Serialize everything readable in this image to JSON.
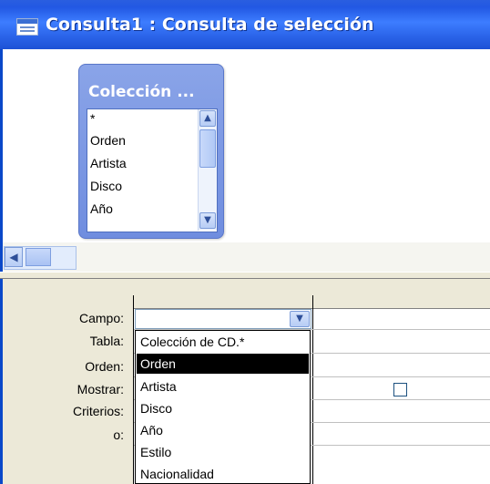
{
  "window": {
    "title": "Consulta1 : Consulta de selección"
  },
  "table_box": {
    "title": "Colección ...",
    "fields": [
      "*",
      "Orden",
      "Artista",
      "Disco",
      "Año"
    ]
  },
  "grid": {
    "row_labels": [
      "Campo:",
      "Tabla:",
      "Orden:",
      "Mostrar:",
      "Criterios:",
      "o:"
    ]
  },
  "dropdown": {
    "options": [
      "Colección de CD.*",
      "Orden",
      "Artista",
      "Disco",
      "Año",
      "Estilo",
      "Nacionalidad"
    ],
    "selected": "Orden"
  },
  "icons": {
    "title_icon": "query-window-icon",
    "scroll_left": "arrow-left-icon",
    "scroll_up": "arrow-up-icon",
    "scroll_down": "arrow-down-icon",
    "combo": "chevron-down-icon"
  },
  "colors": {
    "title_bar": "#2a63e8",
    "selection": "#000000"
  }
}
